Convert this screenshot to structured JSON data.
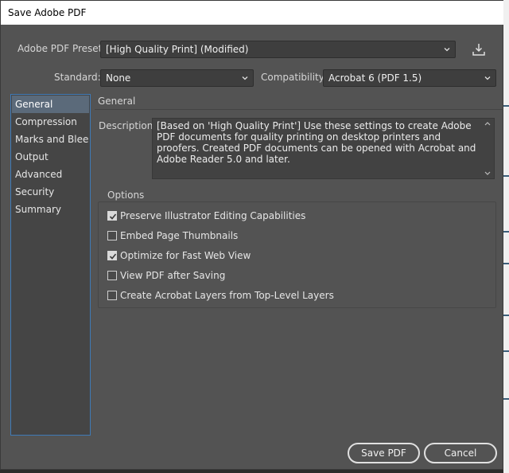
{
  "window": {
    "title": "Save Adobe PDF"
  },
  "preset": {
    "label": "Adobe PDF Preset:",
    "value": "[High Quality Print] (Modified)",
    "save_icon": "save-preset-icon"
  },
  "standard": {
    "label": "Standard:",
    "value": "None"
  },
  "compatibility": {
    "label": "Compatibility:",
    "value": "Acrobat 6 (PDF 1.5)"
  },
  "sidebar": {
    "items": [
      {
        "label": "General",
        "active": true
      },
      {
        "label": "Compression"
      },
      {
        "label": "Marks and Bleeds"
      },
      {
        "label": "Output"
      },
      {
        "label": "Advanced"
      },
      {
        "label": "Security"
      },
      {
        "label": "Summary"
      }
    ]
  },
  "panel": {
    "title": "General",
    "description_label": "Description:",
    "description_text": "[Based on 'High Quality Print'] Use these settings to create Adobe PDF documents for quality printing on desktop printers and proofers.  Created PDF documents can be opened with Acrobat and Adobe Reader 5.0 and later."
  },
  "options": {
    "title": "Options",
    "items": [
      {
        "label": "Preserve Illustrator Editing Capabilities",
        "checked": true
      },
      {
        "label": "Embed Page Thumbnails",
        "checked": false
      },
      {
        "label": "Optimize for Fast Web View",
        "checked": true
      },
      {
        "label": "View PDF after Saving",
        "checked": false
      },
      {
        "label": "Create Acrobat Layers from Top-Level Layers",
        "checked": false
      }
    ]
  },
  "buttons": {
    "save_label": "Save PDF",
    "cancel_label": "Cancel"
  },
  "colors": {
    "dialog_bg": "#535353",
    "accent": "#3f7ab7",
    "selection": "#5b6a7a"
  }
}
